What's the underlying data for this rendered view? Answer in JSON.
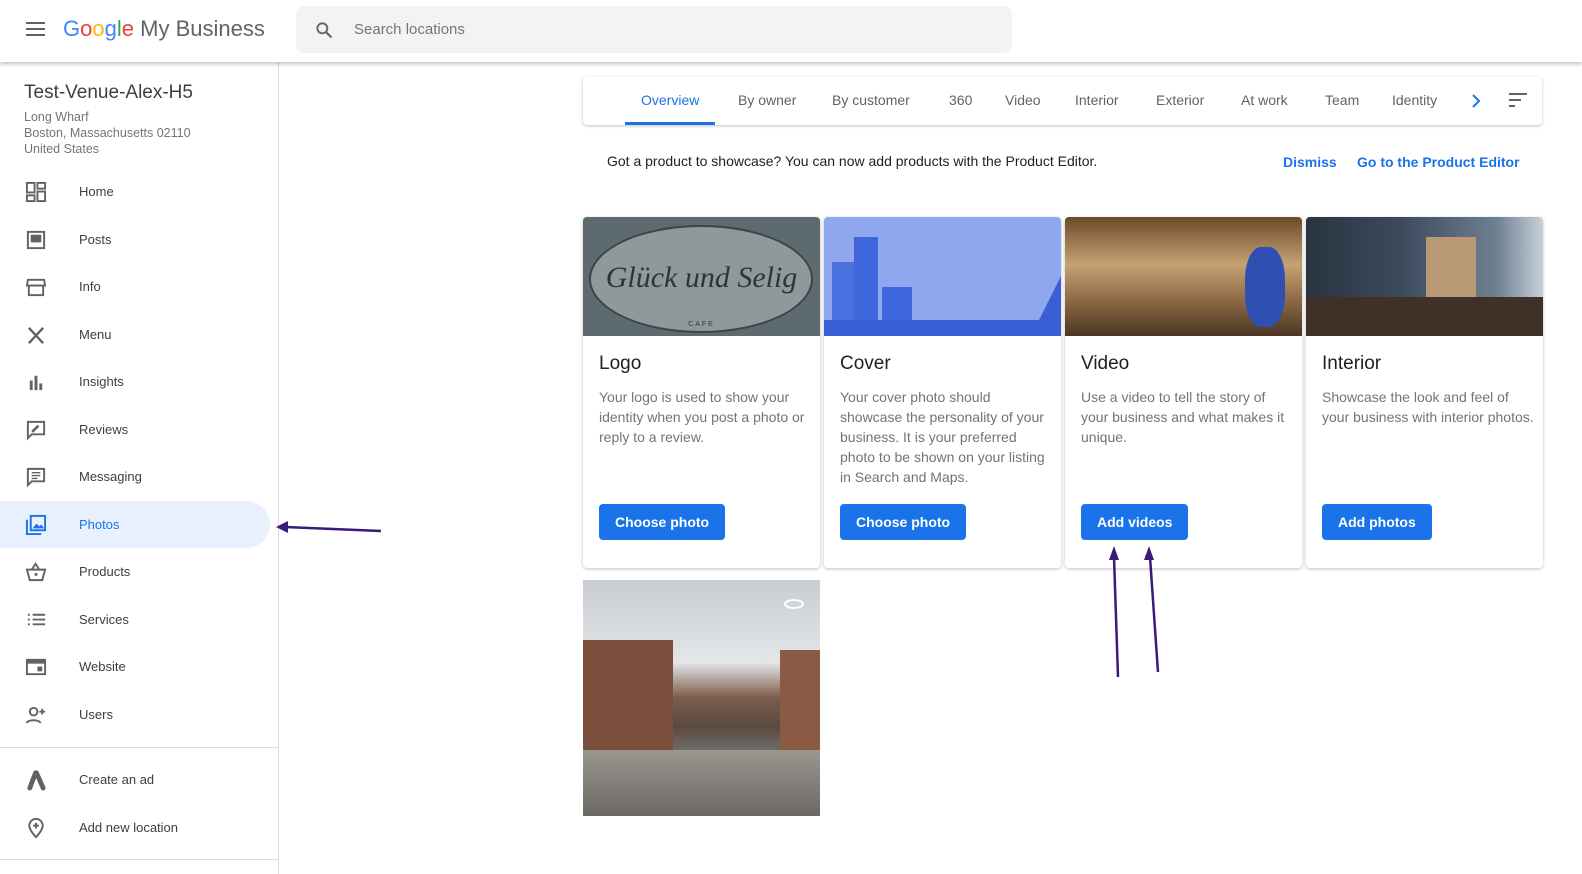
{
  "header": {
    "logo_google": "Google",
    "logo_product": "My Business",
    "search_placeholder": "Search locations"
  },
  "business": {
    "name": "Test-Venue-Alex-H5",
    "address": [
      "Long Wharf",
      "Boston, Massachusetts 02110",
      "United States"
    ]
  },
  "nav": [
    {
      "label": "Home",
      "icon": "dashboard-icon"
    },
    {
      "label": "Posts",
      "icon": "posts-icon"
    },
    {
      "label": "Info",
      "icon": "storefront-icon"
    },
    {
      "label": "Menu",
      "icon": "utensils-icon"
    },
    {
      "label": "Insights",
      "icon": "bar-chart-icon"
    },
    {
      "label": "Reviews",
      "icon": "reviews-icon"
    },
    {
      "label": "Messaging",
      "icon": "message-icon"
    },
    {
      "label": "Photos",
      "icon": "photos-icon",
      "active": true
    },
    {
      "label": "Products",
      "icon": "basket-icon"
    },
    {
      "label": "Services",
      "icon": "list-icon"
    },
    {
      "label": "Website",
      "icon": "website-icon"
    },
    {
      "label": "Users",
      "icon": "add-user-icon"
    }
  ],
  "nav_bottom": [
    {
      "label": "Create an ad",
      "icon": "google-ads-icon"
    },
    {
      "label": "Add new location",
      "icon": "add-location-icon"
    }
  ],
  "tabs": [
    "Overview",
    "By owner",
    "By customer",
    "360",
    "Video",
    "Interior",
    "Exterior",
    "At work",
    "Team",
    "Identity"
  ],
  "active_tab": "Overview",
  "banner": {
    "text": "Got a product to showcase? You can now add products with the Product Editor.",
    "dismiss": "Dismiss",
    "go": "Go to the Product Editor"
  },
  "cards": [
    {
      "title": "Logo",
      "desc": "Your logo is used to show your identity when you post a photo or reply to a review.",
      "button": "Choose photo"
    },
    {
      "title": "Cover",
      "desc": "Your cover photo should showcase the personality of your business. It is your preferred photo to be shown on your listing in Search and Maps.",
      "button": "Choose photo"
    },
    {
      "title": "Video",
      "desc": "Use a video to tell the story of your business and what makes it unique.",
      "button": "Add videos"
    },
    {
      "title": "Interior",
      "desc": "Showcase the look and feel of your business with interior photos.",
      "button": "Add photos"
    }
  ],
  "logo_image_text": {
    "name": "Glück und Selig",
    "sub": "CAFE"
  },
  "colors": {
    "accent": "#1a73e8",
    "active_bg": "#e8f0fe",
    "annotation": "#3b1a7a"
  }
}
